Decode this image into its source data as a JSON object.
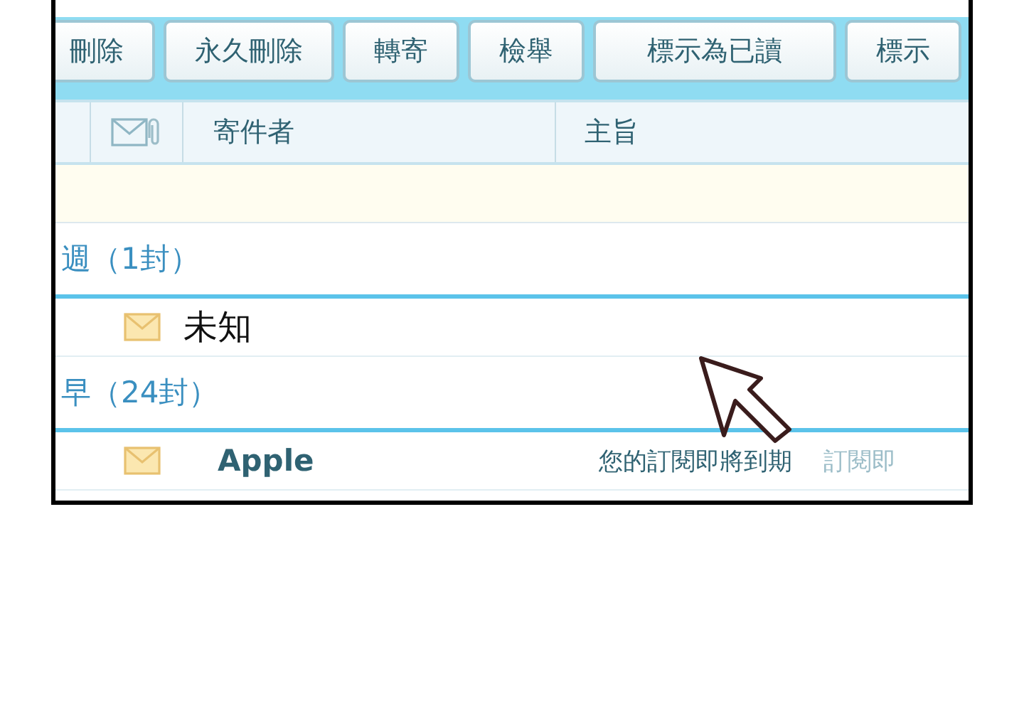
{
  "toolbar": {
    "buttons": [
      "刪除",
      "永久刪除",
      "轉寄",
      "檢舉",
      "標示為已讀",
      "標示"
    ]
  },
  "columns": {
    "sender": "寄件者",
    "subject": "主旨"
  },
  "groups": [
    {
      "label": "週（1封）",
      "messages": [
        {
          "sender": "未知",
          "unread": false
        }
      ]
    },
    {
      "label": "早（24封）",
      "messages": [
        {
          "sender": "Apple",
          "unread": true,
          "subject": "您的訂閱即將到期",
          "preview": "訂閱即"
        }
      ]
    }
  ]
}
